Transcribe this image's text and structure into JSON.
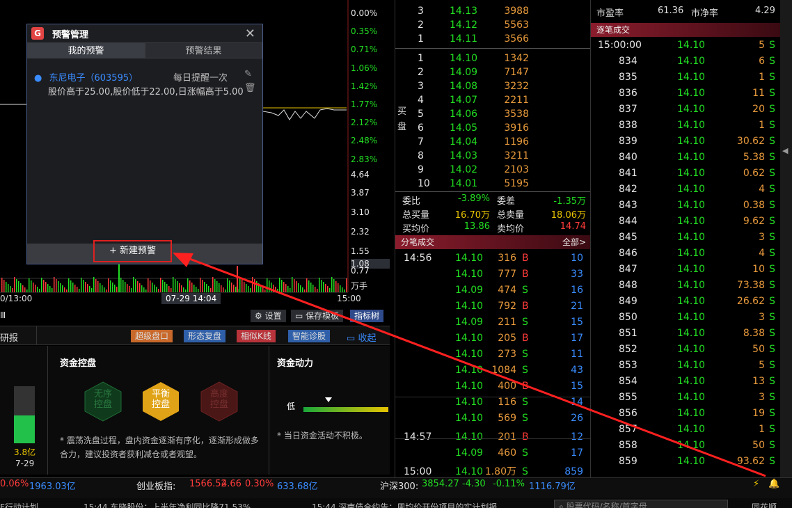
{
  "chart": {
    "percent_labels": [
      {
        "t": "0.00%",
        "c": "w"
      },
      {
        "t": "0.35%",
        "c": "g"
      },
      {
        "t": "0.71%",
        "c": "g"
      },
      {
        "t": "1.06%",
        "c": "g"
      },
      {
        "t": "1.42%",
        "c": "g"
      },
      {
        "t": "1.77%",
        "c": "g"
      },
      {
        "t": "2.12%",
        "c": "g"
      },
      {
        "t": "2.48%",
        "c": "g"
      },
      {
        "t": "2.83%",
        "c": "g"
      }
    ],
    "volume_labels": [
      "4.64",
      "3.87",
      "3.10",
      "2.32",
      "1.55",
      "1.08",
      "0.77",
      "万手"
    ],
    "time_left": "0/13:00",
    "time_cursor": "07-29 14:04",
    "time_right": "15:00",
    "toolbar": {
      "settings": "设置",
      "save": "保存模板",
      "indicator": "指标树"
    }
  },
  "bottom_tabs": {
    "left_label": "研报",
    "b1": "超级盘口",
    "b2": "形态复盘",
    "b3": "相似K线",
    "b4": "智能诊股",
    "collapse": "收起"
  },
  "fund": {
    "control_title": "资金控盘",
    "hex1": "无序\n控盘",
    "hex2": "平衡\n控盘",
    "hex3": "高度\n控盘",
    "desc": "* 震荡洗盘过程，盘内资金逐渐有序化，逐渐形成做多合力，建议投资者获利减仓或者观望。",
    "bar_value": "3.8亿",
    "bar_date": "7-29",
    "power_title": "资金动力",
    "power_low": "低",
    "power_desc": "* 当日资金活动不积极。"
  },
  "dialog": {
    "title": "预警管理",
    "tab_mine": "我的预警",
    "tab_result": "预警结果",
    "stock": "东尼电子（603595）",
    "freq": "每日提醒一次",
    "condition": "股价高于25.00,股价低于22.00,日涨幅高于5.00",
    "new_btn": "+ 新建预警"
  },
  "orderbook": {
    "sell": [
      {
        "n": "3",
        "p": "14.13",
        "v": "3988"
      },
      {
        "n": "2",
        "p": "14.12",
        "v": "5563"
      },
      {
        "n": "1",
        "p": "14.11",
        "v": "3566"
      }
    ],
    "buy_label": "买盘",
    "buy": [
      {
        "n": "1",
        "p": "14.10",
        "v": "1342"
      },
      {
        "n": "2",
        "p": "14.09",
        "v": "7147"
      },
      {
        "n": "3",
        "p": "14.08",
        "v": "3232"
      },
      {
        "n": "4",
        "p": "14.07",
        "v": "2211"
      },
      {
        "n": "5",
        "p": "14.06",
        "v": "3538"
      },
      {
        "n": "6",
        "p": "14.05",
        "v": "3916"
      },
      {
        "n": "7",
        "p": "14.04",
        "v": "1196"
      },
      {
        "n": "8",
        "p": "14.03",
        "v": "3211"
      },
      {
        "n": "9",
        "p": "14.02",
        "v": "2103"
      },
      {
        "n": "10",
        "p": "14.01",
        "v": "5195"
      }
    ],
    "stats": {
      "wb_label": "委比",
      "wb": "-3.89%",
      "wc_label": "委差",
      "wc": "-1.35万",
      "zmr_label": "总买量",
      "zmr": "16.70万",
      "zmc_label": "总卖量",
      "zmc": "18.06万",
      "mrj_label": "买均价",
      "mrj": "13.86",
      "mcj_label": "卖均价",
      "mcj": "14.74"
    }
  },
  "fenbi": {
    "title": "分笔成交",
    "all": "全部>",
    "rows": [
      {
        "t": "14:56",
        "p": "14.10",
        "v": "316",
        "s": "B",
        "n": "10"
      },
      {
        "t": "",
        "p": "14.10",
        "v": "777",
        "s": "B",
        "n": "33"
      },
      {
        "t": "",
        "p": "14.09",
        "v": "474",
        "s": "S",
        "n": "16"
      },
      {
        "t": "",
        "p": "14.10",
        "v": "792",
        "s": "B",
        "n": "21"
      },
      {
        "t": "",
        "p": "14.09",
        "v": "211",
        "s": "S",
        "n": "15"
      },
      {
        "t": "",
        "p": "14.10",
        "v": "205",
        "s": "B",
        "n": "17"
      },
      {
        "t": "",
        "p": "14.10",
        "v": "273",
        "s": "S",
        "n": "11"
      },
      {
        "t": "",
        "p": "14.10",
        "v": "1084",
        "s": "S",
        "n": "43"
      },
      {
        "t": "",
        "p": "14.10",
        "v": "400",
        "s": "B",
        "n": "15"
      },
      {
        "t": "",
        "p": "14.10",
        "v": "116",
        "s": "S",
        "n": "14"
      },
      {
        "t": "",
        "p": "14.10",
        "v": "569",
        "s": "S",
        "n": "26"
      },
      {
        "t": "14:57",
        "p": "14.10",
        "v": "201",
        "s": "B",
        "n": "12"
      },
      {
        "t": "",
        "p": "14.09",
        "v": "460",
        "s": "S",
        "n": "17"
      },
      {
        "t": "15:00",
        "p": "14.10",
        "v": "1.80万",
        "s": "S",
        "n": "859"
      }
    ]
  },
  "zhubi": {
    "pe_label": "市盈率",
    "pe": "61.36",
    "pb_label": "市净率",
    "pb": "4.29",
    "title": "逐笔成交",
    "rows": [
      {
        "i": "15:00:00",
        "p": "14.10",
        "v": "5",
        "s": "S"
      },
      {
        "i": "834",
        "p": "14.10",
        "v": "6",
        "s": "S"
      },
      {
        "i": "835",
        "p": "14.10",
        "v": "1",
        "s": "S"
      },
      {
        "i": "836",
        "p": "14.10",
        "v": "11",
        "s": "S"
      },
      {
        "i": "837",
        "p": "14.10",
        "v": "20",
        "s": "S"
      },
      {
        "i": "838",
        "p": "14.10",
        "v": "1",
        "s": "S"
      },
      {
        "i": "839",
        "p": "14.10",
        "v": "30.62",
        "s": "S"
      },
      {
        "i": "840",
        "p": "14.10",
        "v": "5.38",
        "s": "S"
      },
      {
        "i": "841",
        "p": "14.10",
        "v": "0.62",
        "s": "S"
      },
      {
        "i": "842",
        "p": "14.10",
        "v": "4",
        "s": "S"
      },
      {
        "i": "843",
        "p": "14.10",
        "v": "0.38",
        "s": "S"
      },
      {
        "i": "844",
        "p": "14.10",
        "v": "9.62",
        "s": "S"
      },
      {
        "i": "845",
        "p": "14.10",
        "v": "3",
        "s": "S"
      },
      {
        "i": "846",
        "p": "14.10",
        "v": "4",
        "s": "S"
      },
      {
        "i": "847",
        "p": "14.10",
        "v": "10",
        "s": "S"
      },
      {
        "i": "848",
        "p": "14.10",
        "v": "73.38",
        "s": "S"
      },
      {
        "i": "849",
        "p": "14.10",
        "v": "26.62",
        "s": "S"
      },
      {
        "i": "850",
        "p": "14.10",
        "v": "3",
        "s": "S"
      },
      {
        "i": "851",
        "p": "14.10",
        "v": "8.38",
        "s": "S"
      },
      {
        "i": "852",
        "p": "14.10",
        "v": "50",
        "s": "S"
      },
      {
        "i": "853",
        "p": "14.10",
        "v": "5",
        "s": "S"
      },
      {
        "i": "854",
        "p": "14.10",
        "v": "13",
        "s": "S"
      },
      {
        "i": "855",
        "p": "14.10",
        "v": "3",
        "s": "S"
      },
      {
        "i": "856",
        "p": "14.10",
        "v": "19",
        "s": "S"
      },
      {
        "i": "857",
        "p": "14.10",
        "v": "1",
        "s": "S"
      },
      {
        "i": "858",
        "p": "14.10",
        "v": "50",
        "s": "S"
      },
      {
        "i": "859",
        "p": "14.10",
        "v": "93.62",
        "s": "S"
      }
    ]
  },
  "statusbar": {
    "a1": "0.06%",
    "a2": "1963.03亿",
    "cyb_label": "创业板指:",
    "cyb": "1566.52",
    "cyb_ch": "4.66",
    "cyb_pct": "0.30%",
    "cyb_amt": "633.68亿",
    "hs_label": "沪深300:",
    "hs": "3854.27",
    "hs_ch": "-4.30",
    "hs_pct": "-0.11%",
    "hs_amt": "1116.79亿"
  },
  "ticker": {
    "t1": "F行动计划",
    "t2": "15:44 东晓股份：上半年净利同比降71.53%",
    "t3": "15:44 深南债合约告：周均价开份项目的实计划报",
    "search_placeholder": "股票代码/名称/首字母",
    "login": "同花顺"
  },
  "colors": {
    "accent": "#e24444",
    "up": "#ff3b3b",
    "down": "#22dd22"
  }
}
